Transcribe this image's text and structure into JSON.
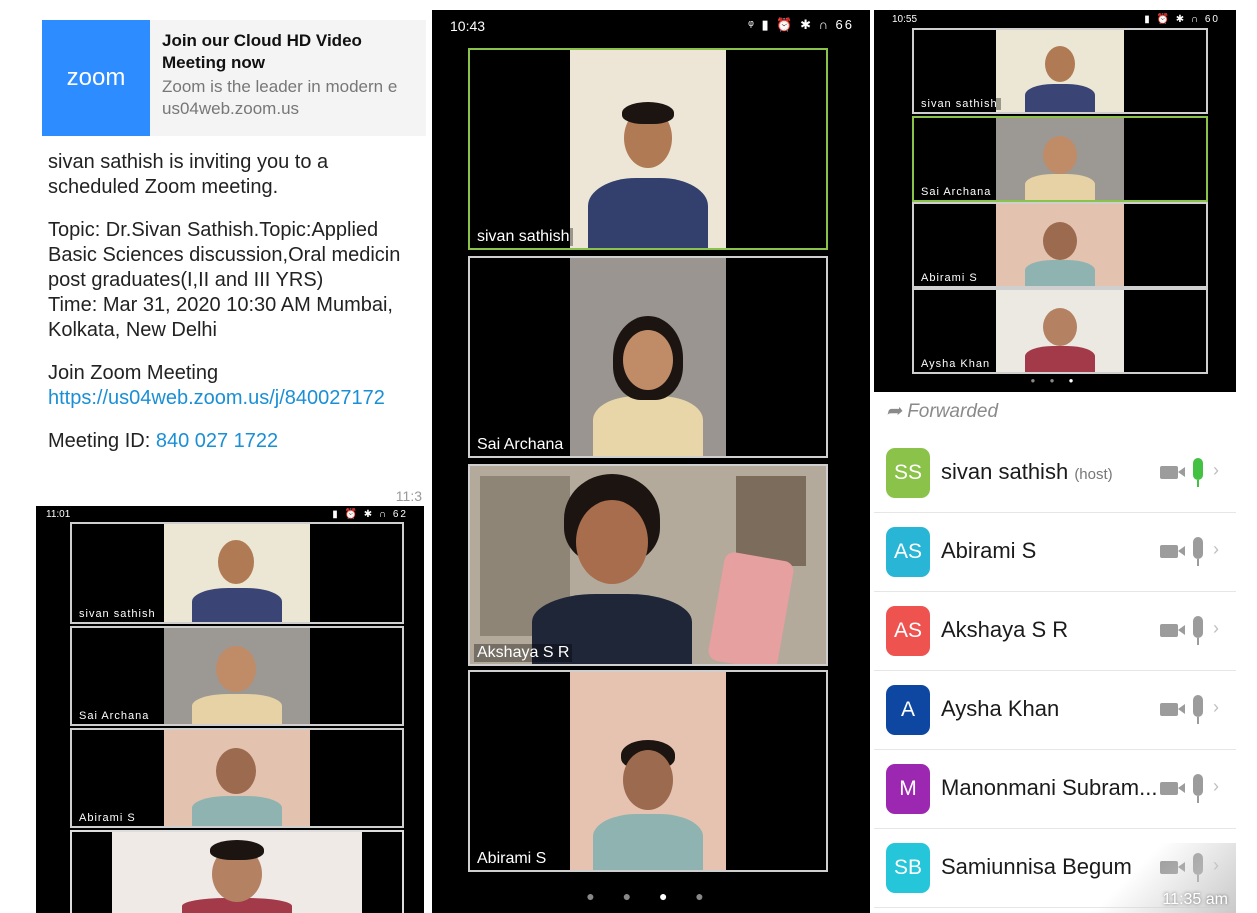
{
  "chat": {
    "preview_title": "Join our Cloud HD Video Meeting now",
    "preview_desc": "Zoom is the leader in modern e",
    "preview_domain": "us04web.zoom.us",
    "logo_text": "zoom",
    "lines": [
      "sivan sathish is inviting you to a",
      "scheduled Zoom meeting.",
      "",
      "Topic: Dr.Sivan Sathish.Topic:Applied",
      "Basic Sciences discussion,Oral medicin",
      "post graduates(I,II and III YRS)",
      "Time: Mar 31, 2020 10:30 AM Mumbai,",
      "Kolkata, New Delhi",
      "",
      "Join Zoom Meeting"
    ],
    "join_link": "https://us04web.zoom.us/j/840027172",
    "meeting_id_label": "Meeting ID:",
    "meeting_id": "840 027 1722",
    "time": "11:3"
  },
  "main_phone": {
    "time": "10:43",
    "status_icons": "ᵠ ▮ ⏰ ✱ ∩ 66",
    "tiles": [
      {
        "label": "sivan sathish",
        "active": true
      },
      {
        "label": "Sai Archana",
        "active": false
      },
      {
        "label": "Akshaya S R",
        "active": false
      },
      {
        "label": "Abirami S",
        "active": false
      }
    ],
    "page_dots": 4,
    "active_dot": 3
  },
  "small_phone_1": {
    "time": "10:55",
    "status_icons": "▮ ⏰ ✱ ∩ 60",
    "tiles": [
      "sivan sathish",
      "Sai Archana",
      "Abirami S",
      "Aysha Khan"
    ],
    "page_dots": 3,
    "active_dot": 3
  },
  "small_phone_2": {
    "time": "11:01",
    "status_icons": "▮ ⏰ ✱ ∩ 62",
    "tiles": [
      "sivan sathish",
      "Sai Archana",
      "Abirami S",
      ""
    ]
  },
  "participants": {
    "forwarded_label": "Forwarded",
    "time": "11:35 am",
    "items": [
      {
        "initials": "SS",
        "name": "sivan sathish",
        "tag": "(host)",
        "color": "#8bc34a",
        "mic_on": true
      },
      {
        "initials": "AS",
        "name": "Abirami S",
        "tag": "",
        "color": "#29b6d6",
        "mic_on": false
      },
      {
        "initials": "AS",
        "name": "Akshaya S R",
        "tag": "",
        "color": "#ef5350",
        "mic_on": false
      },
      {
        "initials": "A",
        "name": "Aysha Khan",
        "tag": "",
        "color": "#0d47a1",
        "mic_on": false
      },
      {
        "initials": "M",
        "name": "Manonmani Subram...",
        "tag": "",
        "color": "#9c27b0",
        "mic_on": false
      },
      {
        "initials": "SB",
        "name": "Samiunnisa Begum",
        "tag": "",
        "color": "#26c6da",
        "mic_on": false
      }
    ]
  }
}
